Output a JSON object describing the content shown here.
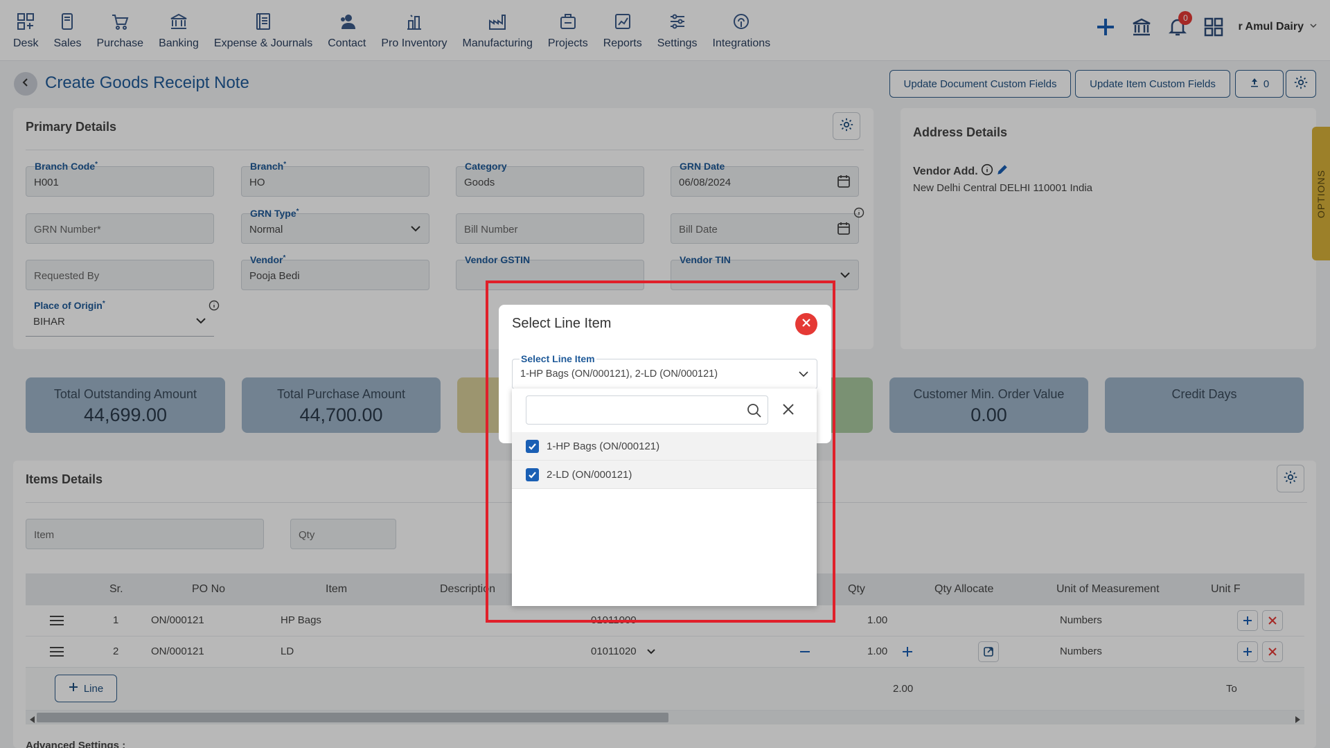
{
  "nav": [
    {
      "label": "Desk",
      "icon": "desk-icon"
    },
    {
      "label": "Sales",
      "icon": "sales-icon"
    },
    {
      "label": "Purchase",
      "icon": "cart-icon"
    },
    {
      "label": "Banking",
      "icon": "bank-icon"
    },
    {
      "label": "Expense & Journals",
      "icon": "journal-icon"
    },
    {
      "label": "Contact",
      "icon": "contact-icon"
    },
    {
      "label": "Pro Inventory",
      "icon": "inventory-icon"
    },
    {
      "label": "Manufacturing",
      "icon": "factory-icon"
    },
    {
      "label": "Projects",
      "icon": "projects-icon"
    },
    {
      "label": "Reports",
      "icon": "reports-icon"
    },
    {
      "label": "Settings",
      "icon": "sliders-icon"
    },
    {
      "label": "Integrations",
      "icon": "integrations-icon"
    }
  ],
  "topright": {
    "notifications": "0",
    "company": "r Amul Dairy"
  },
  "header": {
    "title": "Create Goods Receipt Note",
    "btn_doc_fields": "Update Document Custom Fields",
    "btn_item_fields": "Update Item Custom Fields",
    "upload_count": "0"
  },
  "primary": {
    "title": "Primary Details",
    "branch_code_label": "Branch Code",
    "branch_code": "H001",
    "branch_label": "Branch",
    "branch": "HO",
    "category_label": "Category",
    "category": "Goods",
    "grn_date_label": "GRN Date",
    "grn_date": "06/08/2024",
    "grn_number_placeholder": "GRN Number",
    "grn_type_label": "GRN Type",
    "grn_type": "Normal",
    "bill_number_placeholder": "Bill Number",
    "bill_date_placeholder": "Bill Date",
    "requested_by_placeholder": "Requested By",
    "vendor_label": "Vendor",
    "vendor": "Pooja Bedi",
    "vendor_gstin_label": "Vendor GSTIN",
    "vendor_tin_label": "Vendor TIN",
    "place_label": "Place of Origin",
    "place": "BIHAR",
    "req": "*"
  },
  "address": {
    "title": "Address Details",
    "vendor_add_label": "Vendor Add.",
    "vendor_address": "New Delhi Central DELHI 110001 India"
  },
  "options_tab": "OPTIONS",
  "tiles": [
    {
      "label": "Total Outstanding Amount",
      "value": "44,699.00",
      "color": "#9fb5c9"
    },
    {
      "label": "Total Purchase Amount",
      "value": "44,700.00",
      "color": "#9fb5c9"
    },
    {
      "label": "Customer Min. Order Value",
      "value": "0.00",
      "color": "#9fb5c9"
    },
    {
      "label": "Credit Days",
      "value": "",
      "color": "#9fb5c9"
    }
  ],
  "items": {
    "title": "Items Details",
    "item_placeholder": "Item",
    "qty_placeholder": "Qty",
    "columns": [
      "Sr.",
      "PO No",
      "Item",
      "Description",
      "Qty",
      "Qty Allocate",
      "Unit of Measurement",
      "Unit F"
    ],
    "rows": [
      {
        "sr": "1",
        "po": "ON/000121",
        "item": "HP Bags",
        "hsn": "01011000",
        "qty": "1.00",
        "uom": "Numbers"
      },
      {
        "sr": "2",
        "po": "ON/000121",
        "item": "LD",
        "hsn": "01011020",
        "qty": "1.00",
        "uom": "Numbers"
      }
    ],
    "add_line": "Line",
    "total_qty": "2.00",
    "total_label": "To"
  },
  "advanced": "Advanced Settings :",
  "modal": {
    "title": "Select Line Item",
    "field_label": "Select Line Item",
    "field_value": "1-HP Bags (ON/000121), 2-LD (ON/000121)",
    "search_value": "",
    "options": [
      {
        "label": "1-HP Bags (ON/000121)",
        "checked": true
      },
      {
        "label": "2-LD (ON/000121)",
        "checked": true
      }
    ]
  }
}
